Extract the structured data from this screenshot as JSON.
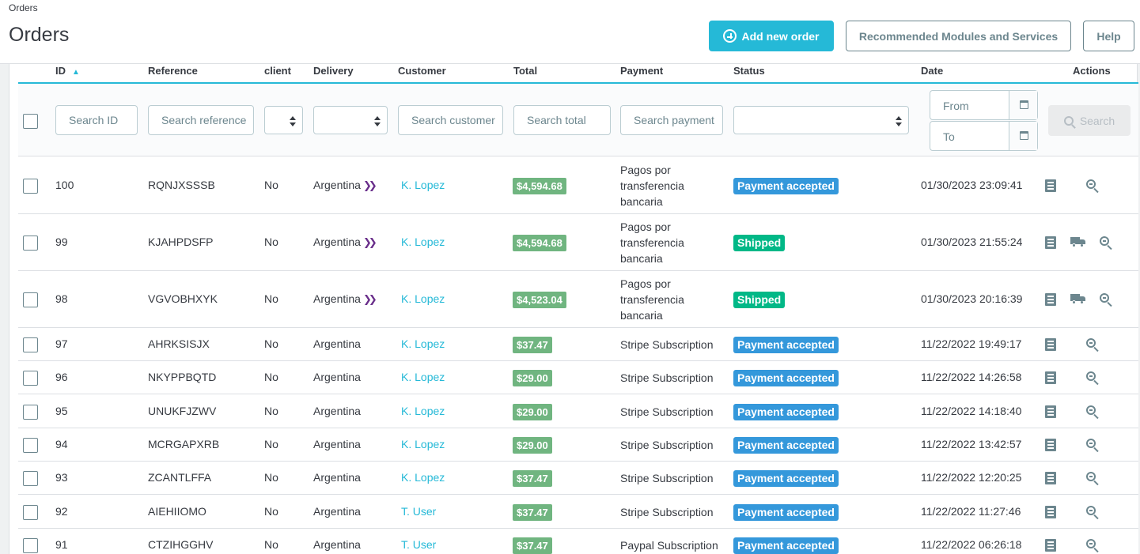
{
  "breadcrumb": "Orders",
  "page_title": "Orders",
  "toolbar": {
    "add_new_order": "Add new order",
    "recommended": "Recommended Modules and Services",
    "help": "Help"
  },
  "columns": {
    "id": "ID",
    "reference": "Reference",
    "client": "client",
    "delivery": "Delivery",
    "customer": "Customer",
    "total": "Total",
    "payment": "Payment",
    "status": "Status",
    "date": "Date",
    "actions": "Actions"
  },
  "filters": {
    "id_placeholder": "Search ID",
    "reference_placeholder": "Search reference",
    "customer_placeholder": "Search customer",
    "total_placeholder": "Search total",
    "payment_placeholder": "Search payment",
    "date_from": "From",
    "date_to": "To",
    "search_button": "Search"
  },
  "colors": {
    "accent": "#25b9d7",
    "payment_accepted": "#3498db",
    "shipped": "#01b887",
    "total_badge": "#70b580"
  },
  "rows": [
    {
      "id": "100",
      "reference": "RQNJXSSSB",
      "client": "No",
      "delivery": "Argentina",
      "delivery_arrow": true,
      "customer": "K. Lopez",
      "total": "$4,594.68",
      "payment": "Pagos por transferencia bancaria",
      "status": "Payment accepted",
      "status_color": "#3498db",
      "date": "01/30/2023 23:09:41",
      "shipping_action": false
    },
    {
      "id": "99",
      "reference": "KJAHPDSFP",
      "client": "No",
      "delivery": "Argentina",
      "delivery_arrow": true,
      "customer": "K. Lopez",
      "total": "$4,594.68",
      "payment": "Pagos por transferencia bancaria",
      "status": "Shipped",
      "status_color": "#01b887",
      "date": "01/30/2023 21:55:24",
      "shipping_action": true
    },
    {
      "id": "98",
      "reference": "VGVOBHXYK",
      "client": "No",
      "delivery": "Argentina",
      "delivery_arrow": true,
      "customer": "K. Lopez",
      "total": "$4,523.04",
      "payment": "Pagos por transferencia bancaria",
      "status": "Shipped",
      "status_color": "#01b887",
      "date": "01/30/2023 20:16:39",
      "shipping_action": true
    },
    {
      "id": "97",
      "reference": "AHRKSISJX",
      "client": "No",
      "delivery": "Argentina",
      "delivery_arrow": false,
      "customer": "K. Lopez",
      "total": "$37.47",
      "payment": "Stripe Subscription",
      "status": "Payment accepted",
      "status_color": "#3498db",
      "date": "11/22/2022 19:49:17",
      "shipping_action": false
    },
    {
      "id": "96",
      "reference": "NKYPPBQTD",
      "client": "No",
      "delivery": "Argentina",
      "delivery_arrow": false,
      "customer": "K. Lopez",
      "total": "$29.00",
      "payment": "Stripe Subscription",
      "status": "Payment accepted",
      "status_color": "#3498db",
      "date": "11/22/2022 14:26:58",
      "shipping_action": false
    },
    {
      "id": "95",
      "reference": "UNUKFJZWV",
      "client": "No",
      "delivery": "Argentina",
      "delivery_arrow": false,
      "customer": "K. Lopez",
      "total": "$29.00",
      "payment": "Stripe Subscription",
      "status": "Payment accepted",
      "status_color": "#3498db",
      "date": "11/22/2022 14:18:40",
      "shipping_action": false
    },
    {
      "id": "94",
      "reference": "MCRGAPXRB",
      "client": "No",
      "delivery": "Argentina",
      "delivery_arrow": false,
      "customer": "K. Lopez",
      "total": "$29.00",
      "payment": "Stripe Subscription",
      "status": "Payment accepted",
      "status_color": "#3498db",
      "date": "11/22/2022 13:42:57",
      "shipping_action": false
    },
    {
      "id": "93",
      "reference": "ZCANTLFFA",
      "client": "No",
      "delivery": "Argentina",
      "delivery_arrow": false,
      "customer": "K. Lopez",
      "total": "$37.47",
      "payment": "Stripe Subscription",
      "status": "Payment accepted",
      "status_color": "#3498db",
      "date": "11/22/2022 12:20:25",
      "shipping_action": false
    },
    {
      "id": "92",
      "reference": "AIEHIIOMO",
      "client": "No",
      "delivery": "Argentina",
      "delivery_arrow": false,
      "customer": "T. User",
      "total": "$37.47",
      "payment": "Stripe Subscription",
      "status": "Payment accepted",
      "status_color": "#3498db",
      "date": "11/22/2022 11:27:46",
      "shipping_action": false
    },
    {
      "id": "91",
      "reference": "CTZIHGGHV",
      "client": "No",
      "delivery": "Argentina",
      "delivery_arrow": false,
      "customer": "T. User",
      "total": "$37.47",
      "payment": "Paypal Subscription",
      "status": "Payment accepted",
      "status_color": "#3498db",
      "date": "11/22/2022 06:26:18",
      "shipping_action": false
    }
  ]
}
